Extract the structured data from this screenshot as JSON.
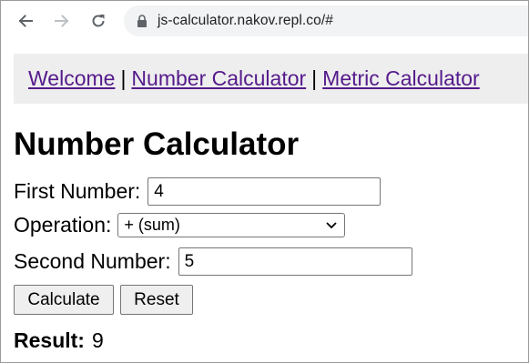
{
  "browser": {
    "url": "js-calculator.nakov.repl.co/#"
  },
  "nav": {
    "links": [
      "Welcome",
      "Number Calculator",
      "Metric Calculator"
    ],
    "separator": "|"
  },
  "page": {
    "title": "Number Calculator"
  },
  "form": {
    "first_label": "First Number:",
    "first_value": "4",
    "operation_label": "Operation:",
    "operation_selected": "+ (sum)",
    "second_label": "Second Number:",
    "second_value": "5",
    "calculate_label": "Calculate",
    "reset_label": "Reset"
  },
  "result": {
    "label": "Result:",
    "value": "9"
  },
  "colors": {
    "link": "#551a8b",
    "navbar_bg": "#eeeeee",
    "omnibox_bg": "#f1f3f4",
    "button_bg": "#efefef"
  },
  "icons": [
    "back-arrow-icon",
    "forward-arrow-icon",
    "reload-icon",
    "lock-icon",
    "chevron-down-icon"
  ]
}
